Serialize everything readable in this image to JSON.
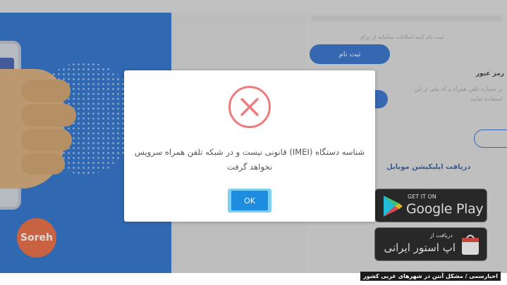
{
  "background_page": {
    "register_button_label": "ثبت نام",
    "register_hint": "ثبت نام کنید امکانات سامانه از برای",
    "password_section_title": "رمز عبور",
    "password_hint_line1": "بر شماره تلفن همراه و کد ملی از این",
    "password_hint_line2": "استفاده نمایید",
    "app_section_title": "دریافت اپلیکیشن موبایل",
    "google_play": {
      "small_text": "GET IT ON",
      "big_text": "Google Play"
    },
    "iranian_store": {
      "small_text": "دریافت از",
      "big_text": "اپ استور ایرانی"
    },
    "brand_logo_text": "Soreh"
  },
  "dialog": {
    "icon": "error-x-circle-icon",
    "message_line1": "شناسه دستگاه (IMEI) قانونی نیست و در شبکه تلفن همراه سرویس",
    "message_line2": "نخواهد گرفت",
    "ok_label": "OK"
  },
  "caption": {
    "text": "اخبارسمی / مشکل آنتن در شهرهای غربی کشور"
  },
  "colors": {
    "brand_blue": "#1565c9",
    "error_red": "#f07b7b",
    "ok_button": "#1e8de0",
    "caption_bg": "#1b1b1b"
  }
}
